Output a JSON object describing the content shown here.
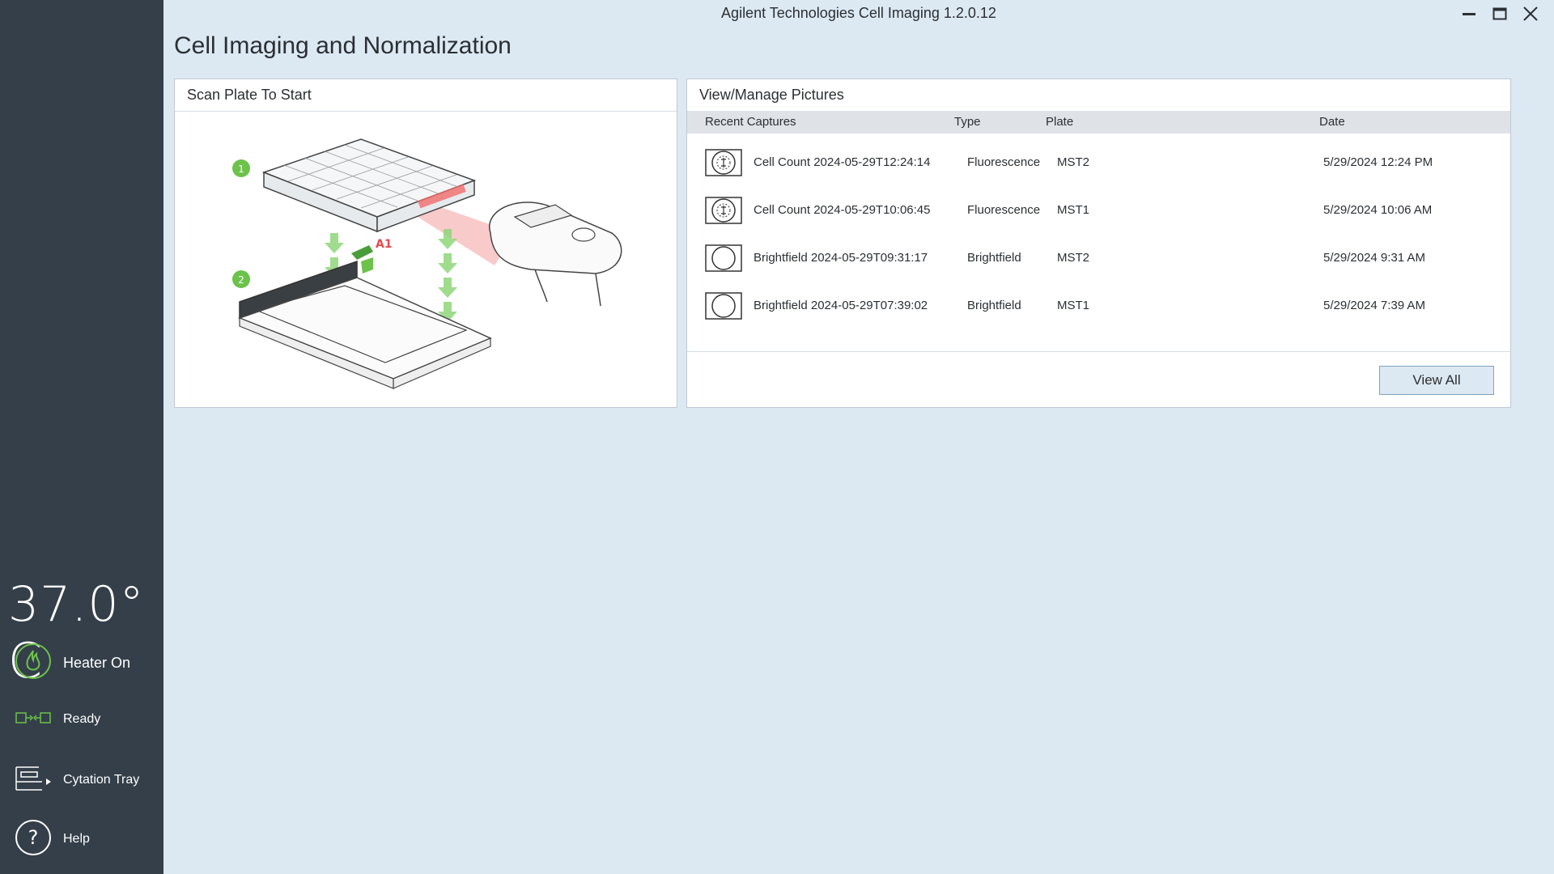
{
  "window": {
    "title": "Agilent Technologies Cell Imaging 1.2.0.12"
  },
  "page": {
    "title": "Cell Imaging and Normalization"
  },
  "sidebar": {
    "temperature": "37.0° C",
    "items": [
      {
        "label": "Heater On",
        "icon": "flame-icon"
      },
      {
        "label": "Ready",
        "icon": "connection-icon"
      },
      {
        "label": "Cytation Tray",
        "icon": "tray-icon"
      },
      {
        "label": "Help",
        "icon": "help-icon"
      }
    ]
  },
  "scan_panel": {
    "title": "Scan Plate To Start",
    "step1": "1",
    "step2": "2",
    "well_label": "A1"
  },
  "pictures_panel": {
    "title": "View/Manage Pictures",
    "columns": [
      "Recent Captures",
      "Type",
      "Plate",
      "Date"
    ],
    "rows": [
      {
        "name": "Cell Count 2024-05-29T12:24:14",
        "type": "Fluorescence",
        "plate": "MST2",
        "date": "5/29/2024 12:24 PM",
        "icon": "fluorescence-icon"
      },
      {
        "name": "Cell Count 2024-05-29T10:06:45",
        "type": "Fluorescence",
        "plate": "MST1",
        "date": "5/29/2024 10:06 AM",
        "icon": "fluorescence-icon"
      },
      {
        "name": "Brightfield 2024-05-29T09:31:17",
        "type": "Brightfield",
        "plate": "MST2",
        "date": "5/29/2024 9:31 AM",
        "icon": "brightfield-icon"
      },
      {
        "name": "Brightfield 2024-05-29T07:39:02",
        "type": "Brightfield",
        "plate": "MST1",
        "date": "5/29/2024 7:39 AM",
        "icon": "brightfield-icon"
      }
    ],
    "view_all_label": "View All"
  },
  "colors": {
    "sidebar": "#343f49",
    "background": "#dce9f3",
    "accent_green": "#6cc24a",
    "laser_red": "#f26b6b"
  }
}
